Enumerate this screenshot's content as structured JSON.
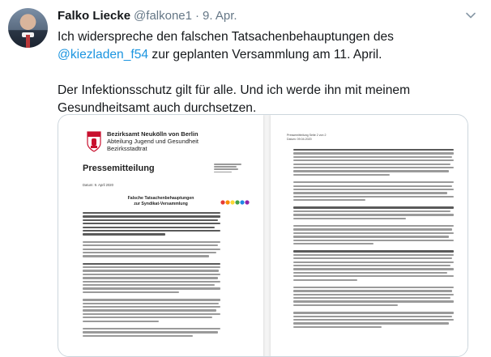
{
  "tweet": {
    "author_name": "Falko Liecke",
    "handle": "@falkone1",
    "separator": "·",
    "date": "9. Apr.",
    "text_p1_before": "Ich widerspreche den falschen Tatsachenbehauptungen des ",
    "mention": "@kiezladen_f54",
    "text_p1_after": " zur geplanten Versammlung am 11. April.",
    "text_p2": "Der Infektionsschutz gilt für alle. Und ich werde ihn mit meinem Gesundheitsamt auch durchsetzen."
  },
  "icons": {
    "more": "chevron-down-icon",
    "crest": "berlin-bear-crest-icon",
    "logo": "colored-dots-logo"
  },
  "colors": {
    "link": "#1b95e0",
    "text": "#14171a",
    "muted": "#657786",
    "border": "#ccd6dd",
    "crest_red": "#c8102e"
  },
  "document": {
    "org_line1": "Bezirksamt Neukölln von Berlin",
    "org_line2": "Abteilung Jugend und Gesundheit",
    "org_line3": "Bezirksstadtrat",
    "title": "Pressemitteilung",
    "date": "Datum: 9. April 2020",
    "heading_line1": "Falsche Tatsachenbehauptungen",
    "heading_line2": "zur Syndikat-Versammlung",
    "page2_header_line1": "Pressemitteilung Seite 2 von 2",
    "page2_header_line2": "Datum: 09.04.2020"
  }
}
